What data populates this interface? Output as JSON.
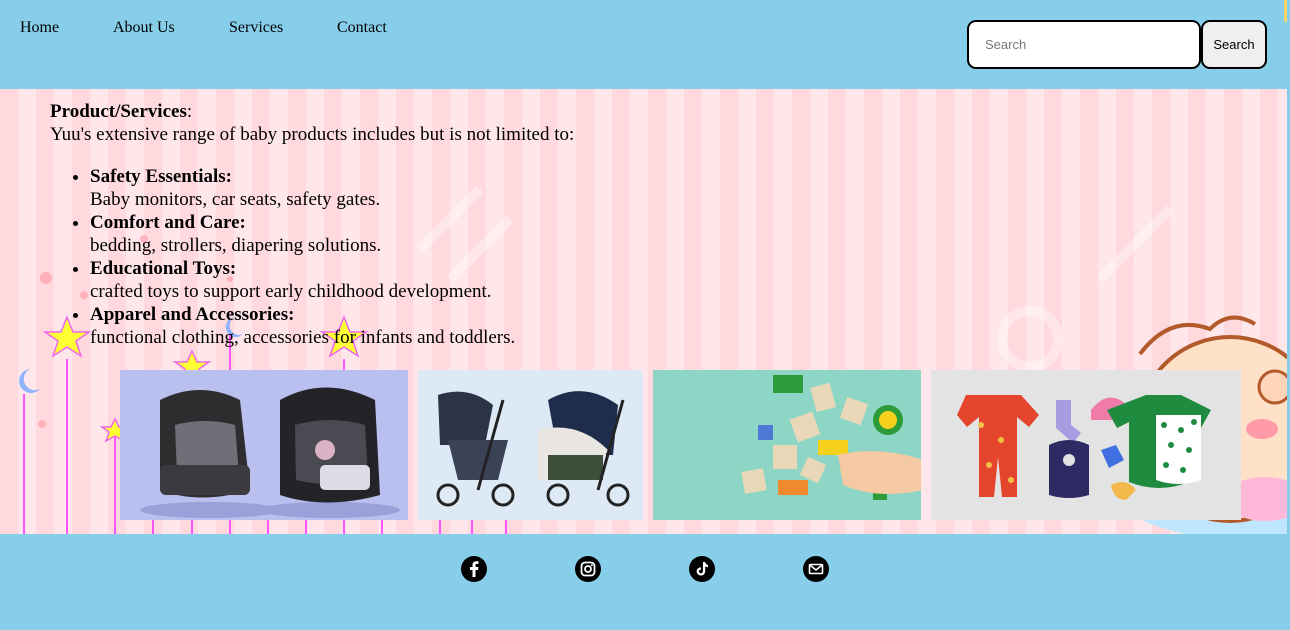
{
  "header": {
    "nav": [
      "Home",
      "About Us",
      "Services",
      "Contact"
    ],
    "search": {
      "placeholder": "Search",
      "button_label": "Search"
    }
  },
  "main": {
    "heading": "Product/Services",
    "heading_suffix": ":",
    "intro": "Yuu's extensive range of baby products includes but is not limited to:",
    "items": [
      {
        "title": "Safety Essentials:",
        "text": "Baby monitors, car seats, safety gates."
      },
      {
        "title": "Comfort and Care:",
        "text": "bedding, strollers, diapering solutions."
      },
      {
        "title": "Educational Toys:",
        "text": "crafted toys to support early childhood development."
      },
      {
        "title": "Apparel and Accessories:",
        "text": "functional clothing, accessories for infants and toddlers."
      }
    ],
    "photos": [
      {
        "name": "car-seats-photo"
      },
      {
        "name": "strollers-photo"
      },
      {
        "name": "toys-photo"
      },
      {
        "name": "baby-clothes-photo"
      }
    ]
  },
  "footer": {
    "icons": [
      "facebook-icon",
      "instagram-icon",
      "tiktok-icon",
      "email-icon"
    ]
  },
  "colors": {
    "header_bg": "#87ceeb",
    "main_bg": "#ffd9de",
    "star": "#ffff33",
    "pole": "#ff55ff"
  }
}
